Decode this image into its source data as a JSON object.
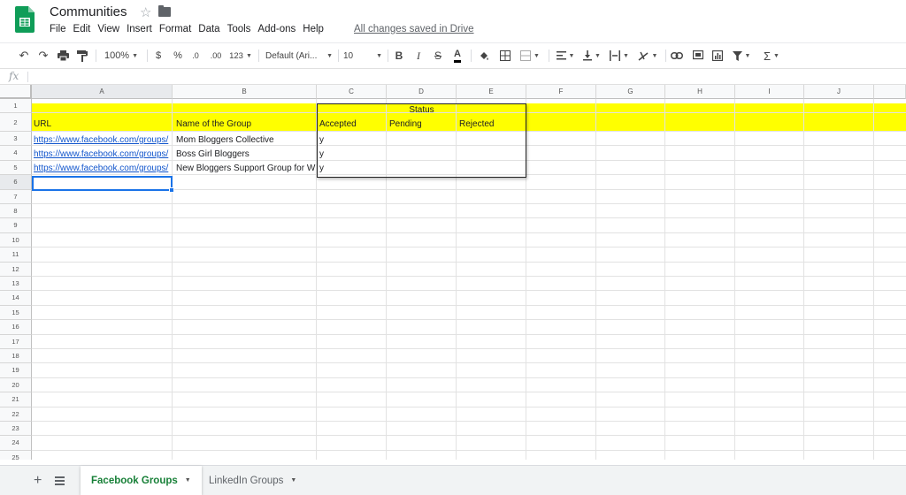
{
  "app": {
    "doc_title": "Communities",
    "save_status": "All changes saved in Drive"
  },
  "menu": [
    "File",
    "Edit",
    "View",
    "Insert",
    "Format",
    "Data",
    "Tools",
    "Add-ons",
    "Help"
  ],
  "toolbar": {
    "zoom": "100%",
    "currency": "$",
    "percent": "%",
    "decrease_decimal": ".0",
    "increase_decimal": ".00",
    "more_formats": "123",
    "font": "Default (Ari...",
    "font_size": "10",
    "bold": "B",
    "italic": "I",
    "strike": "S",
    "text_color": "A",
    "sum": "Σ"
  },
  "formula": {
    "fx": "fx"
  },
  "columns": [
    "A",
    "B",
    "C",
    "D",
    "E",
    "F",
    "G",
    "H",
    "I",
    "J"
  ],
  "rows": [
    "1",
    "2",
    "3",
    "4",
    "5",
    "6",
    "7",
    "8",
    "9",
    "10",
    "11",
    "12",
    "13",
    "14",
    "15",
    "16",
    "17",
    "18",
    "19",
    "20",
    "21",
    "22",
    "23",
    "24",
    "25"
  ],
  "cells": {
    "status_header": "Status",
    "a2": "URL",
    "b2": "Name of the Group",
    "c2": "Accepted",
    "d2": "Pending",
    "e2": "Rejected",
    "a3": "https://www.facebook.com/groups/",
    "b3": "Mom Bloggers Collective",
    "c3": "y",
    "a4": "https://www.facebook.com/groups/",
    "b4": "Boss Girl Bloggers",
    "c4": "y",
    "a5": "https://www.facebook.com/groups/",
    "b5": "New Bloggers Support Group for W",
    "c5": "y"
  },
  "sheets": [
    {
      "label": "Facebook Groups",
      "active": true
    },
    {
      "label": "LinkedIn Groups",
      "active": false
    }
  ],
  "colors": {
    "highlight": "#ffff00",
    "selection": "#1a73e8",
    "active_tab": "#188038",
    "link": "#1155cc"
  }
}
